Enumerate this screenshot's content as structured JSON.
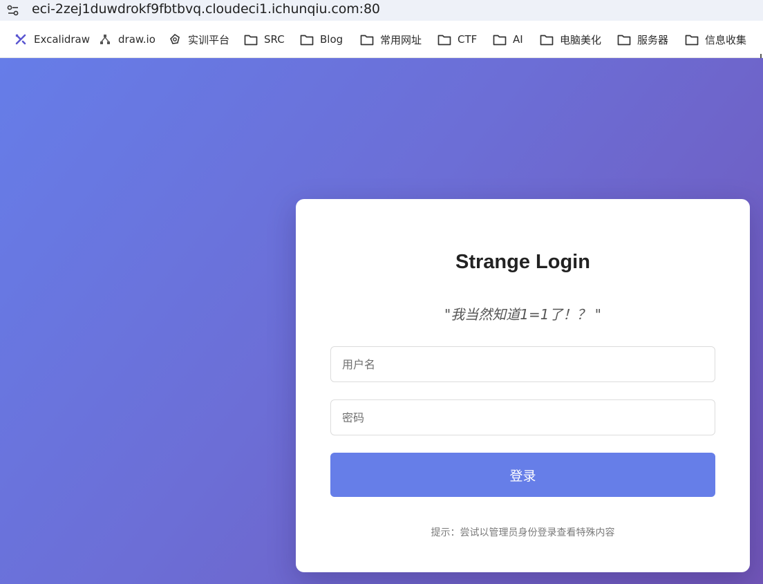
{
  "browser": {
    "url": "eci-2zej1duwdrokf9fbtbvq.cloudeci1.ichunqiu.com:80",
    "site_info_icon": "tune-icon"
  },
  "bookmarks": [
    {
      "label": "Excalidraw",
      "icon": "excalidraw-icon"
    },
    {
      "label": "draw.io",
      "icon": "drawio-icon"
    },
    {
      "label": "实训平台",
      "icon": "platform-icon"
    },
    {
      "label": "SRC",
      "icon": "folder-icon"
    },
    {
      "label": "Blog",
      "icon": "folder-icon"
    },
    {
      "label": "常用网址",
      "icon": "folder-icon"
    },
    {
      "label": "CTF",
      "icon": "folder-icon"
    },
    {
      "label": "AI",
      "icon": "folder-icon"
    },
    {
      "label": "电脑美化",
      "icon": "folder-icon"
    },
    {
      "label": "服务器",
      "icon": "folder-icon"
    },
    {
      "label": "信息收集",
      "icon": "folder-icon"
    }
  ],
  "login": {
    "title": "Strange Login",
    "quote": "\"我当然知道1=1了！？ \"",
    "username_placeholder": "用户名",
    "password_placeholder": "密码",
    "submit_label": "登录",
    "hint": "提示：尝试以管理员身份登录查看特殊内容"
  },
  "colors": {
    "gradient_start": "#667de8",
    "gradient_end": "#7156b8",
    "button": "#667ee8",
    "card": "#ffffff"
  }
}
